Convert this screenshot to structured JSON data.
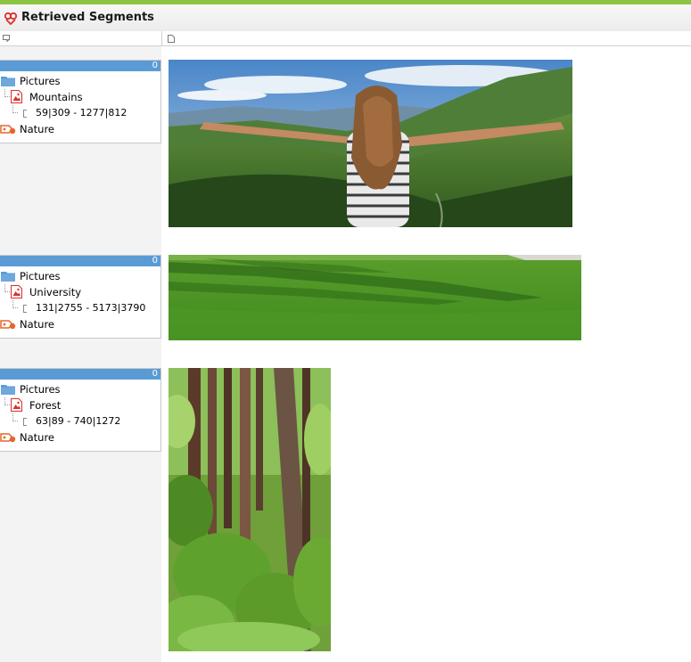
{
  "window": {
    "title": "Retrieved Segments"
  },
  "header": {
    "col1_icon": "memo-icon",
    "col2_icon": "document-icon"
  },
  "segments": [
    {
      "count": "0",
      "folder": "Pictures",
      "document": "Mountains",
      "coords": "59|309 - 1277|812",
      "code": "Nature",
      "image": "mountains-photo"
    },
    {
      "count": "0",
      "folder": "Pictures",
      "document": "University",
      "coords": "131|2755 - 5173|3790",
      "code": "Nature",
      "image": "grass-photo"
    },
    {
      "count": "0",
      "folder": "Pictures",
      "document": "Forest",
      "coords": "63|89 - 740|1272",
      "code": "Nature",
      "image": "forest-photo"
    }
  ],
  "colors": {
    "accent_bar": "#8dc343",
    "card_header": "#5b9bd5",
    "folder": "#5b9bd5",
    "doc_icon": "#e04a3a",
    "code_icon": "#e5662a"
  }
}
